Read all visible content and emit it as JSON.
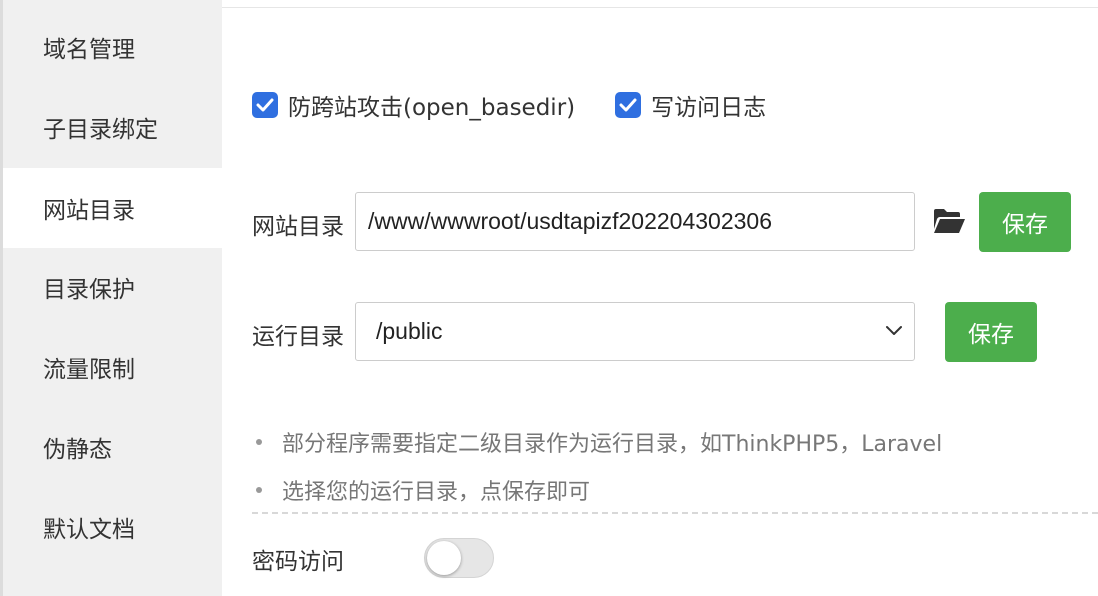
{
  "sidebar": {
    "items": [
      {
        "label": "域名管理",
        "active": false
      },
      {
        "label": "子目录绑定",
        "active": false
      },
      {
        "label": "网站目录",
        "active": true
      },
      {
        "label": "目录保护",
        "active": false
      },
      {
        "label": "流量限制",
        "active": false
      },
      {
        "label": "伪静态",
        "active": false
      },
      {
        "label": "默认文档",
        "active": false
      }
    ]
  },
  "options": {
    "anti_xss_label": "防跨站攻击(open_basedir)",
    "anti_xss_checked": true,
    "access_log_label": "写访问日志",
    "access_log_checked": true
  },
  "site_dir": {
    "label": "网站目录",
    "value": "/www/wwwroot/usdtapizf202204302306",
    "folder_icon": "folder-open-icon",
    "save_label": "保存"
  },
  "run_dir": {
    "label": "运行目录",
    "selected": "/public",
    "save_label": "保存"
  },
  "tips": [
    "部分程序需要指定二级目录作为运行目录，如ThinkPHP5，Laravel",
    "选择您的运行目录，点保存即可"
  ],
  "password_access": {
    "label": "密码访问",
    "enabled": false
  },
  "colors": {
    "primary_button": "#4cae4c",
    "checkbox": "#2f6fe0",
    "sidebar_bg": "#f0f0f0"
  }
}
